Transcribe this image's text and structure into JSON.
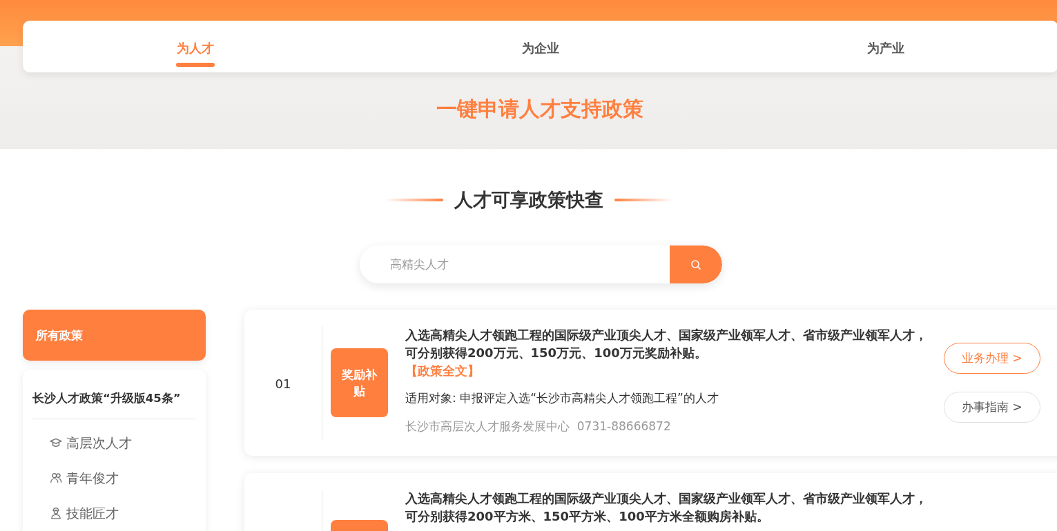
{
  "tabs": [
    {
      "label": "为人才",
      "selected": true
    },
    {
      "label": "为企业",
      "selected": false
    },
    {
      "label": "为产业",
      "selected": false
    }
  ],
  "banner_title": "一键申请人才支持政策",
  "section_title": "人才可享政策快查",
  "search": {
    "placeholder": "高精尖人才"
  },
  "sidebar": {
    "all": {
      "label": "所有政策",
      "selected": true
    },
    "group": {
      "title": "长沙人才政策“升级版45条”",
      "items": [
        {
          "label": "高层次人才",
          "kind": "cap"
        },
        {
          "label": "青年俊才",
          "kind": "people"
        },
        {
          "label": "技能匠才",
          "kind": "worker"
        }
      ]
    }
  },
  "policies": [
    {
      "number": "01",
      "tag": "奖励补贴",
      "title": "入选高精尖人才领跑工程的国际级产业顶尖人才、国家级产业领军人才、省市级产业领军人才，可分别获得200万元、150万元、100万元奖励补贴。",
      "full_text": "【政策全文】",
      "target": "适用对象: 申报评定入选“长沙市高精尖人才领跑工程”的人才",
      "contact": "长沙市高层次人才服务发展中心  0731-88666872",
      "buttons": [
        {
          "label": "业务办理 >",
          "kind": "primary"
        },
        {
          "label": "办事指南 >",
          "kind": "secondary"
        }
      ]
    },
    {
      "title": "入选高精尖人才领跑工程的国际级产业顶尖人才、国家级产业领军人才、省市级产业领军人才，可分别获得200平方米、150平方米、100平方米全额购房补贴。"
    }
  ]
}
